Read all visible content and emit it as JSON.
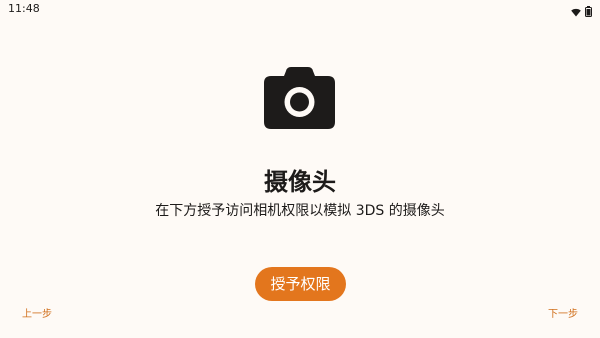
{
  "status_bar": {
    "time": "11:48",
    "icons": [
      "wifi-icon",
      "battery-icon"
    ]
  },
  "camera_icon": "camera-icon",
  "title": "摄像头",
  "subtitle": "在下方授予访问相机权限以模拟 3DS 的摄像头",
  "grant_button": {
    "label": "授予权限",
    "color": "#e3761d"
  },
  "navigation": {
    "prev_label": "上一步",
    "next_label": "下一步",
    "color": "#d06e1a"
  },
  "background_color": "#fefaf6"
}
